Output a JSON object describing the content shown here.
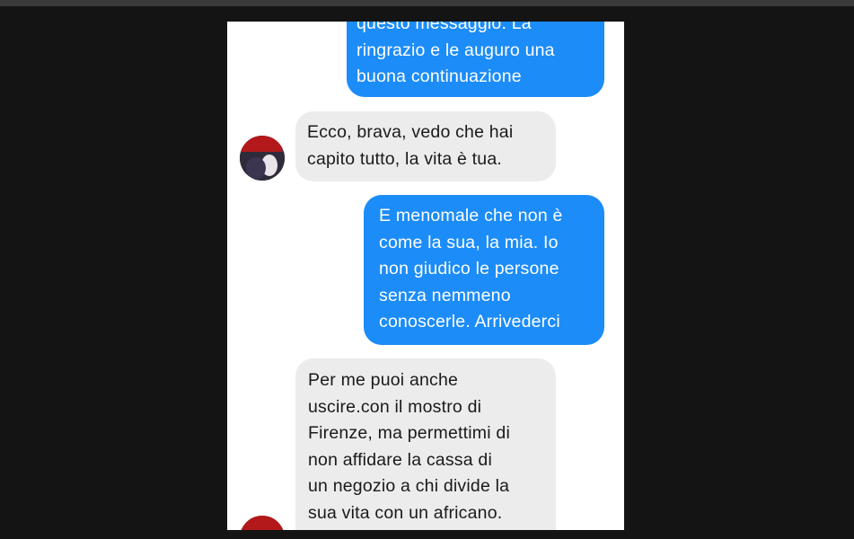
{
  "conversation": {
    "messages": [
      {
        "direction": "sent",
        "lines": [
          "questo messaggio. La",
          "ringrazio e le auguro una",
          "buona continuazione"
        ]
      },
      {
        "direction": "received",
        "lines": [
          "Ecco, brava, vedo che hai",
          "capito tutto, la vita è tua."
        ]
      },
      {
        "direction": "sent",
        "lines": [
          "E menomale che non è",
          "come la sua, la mia. Io",
          "non giudico le persone",
          "senza nemmeno",
          "conoscerle. Arrivederci"
        ]
      },
      {
        "direction": "received",
        "lines": [
          "Per me puoi anche",
          "uscire.con il mostro di",
          "Firenze, ma permettimi di",
          "non affidare la cassa di",
          "un negozio a chi divide la",
          "sua vita con un africano."
        ]
      }
    ]
  },
  "colors": {
    "sent_bubble": "#1c8cf8",
    "received_bubble": "#ececec",
    "background": "#141414"
  }
}
